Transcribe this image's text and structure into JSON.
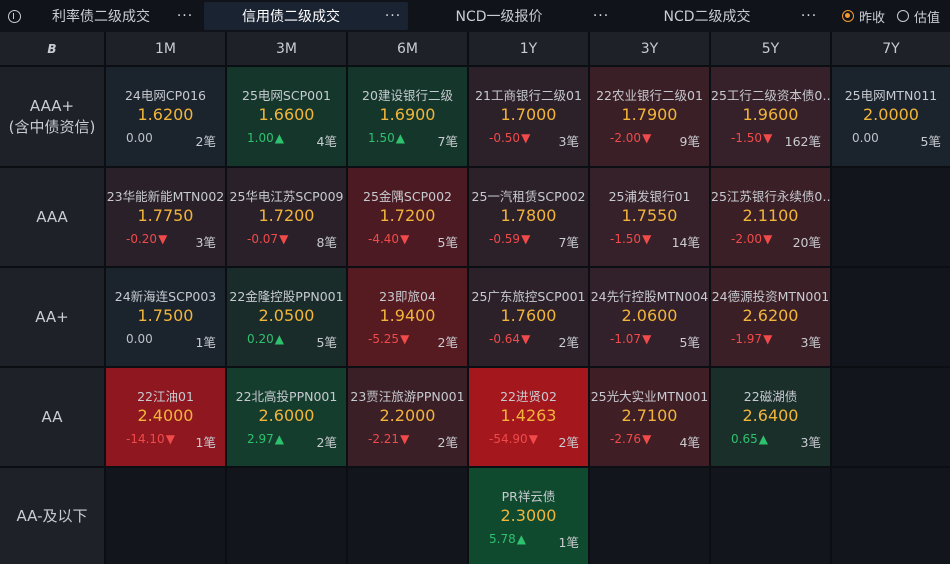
{
  "tabs": [
    {
      "label": "利率债二级成交",
      "active": false
    },
    {
      "label": "信用债二级成交",
      "active": true
    },
    {
      "label": "NCD一级报价",
      "active": false
    },
    {
      "label": "NCD二级成交",
      "active": false
    }
  ],
  "more_label": "···",
  "radio": [
    {
      "label": "昨收",
      "selected": true
    },
    {
      "label": "估值",
      "selected": false
    }
  ],
  "corner_label": "B",
  "columns": [
    "1M",
    "3M",
    "6M",
    "1Y",
    "3Y",
    "5Y",
    "7Y"
  ],
  "rows": [
    "AAA+\n(含中债资信)",
    "AAA",
    "AA+",
    "AA",
    "AA-及以下"
  ],
  "cells": [
    [
      {
        "name": "24电网CP016",
        "price": "1.6200",
        "change": "0.00",
        "arrow": "",
        "dir": "flat",
        "count": "2笔",
        "bg": "#1b232c"
      },
      {
        "name": "25电网SCP001",
        "price": "1.6600",
        "change": "1.00",
        "arrow": "▲",
        "dir": "up",
        "count": "4笔",
        "bg": "#15372b"
      },
      {
        "name": "20建设银行二级",
        "price": "1.6900",
        "change": "1.50",
        "arrow": "▲",
        "dir": "up",
        "count": "7笔",
        "bg": "#15372b"
      },
      {
        "name": "21工商银行二级01",
        "price": "1.7000",
        "change": "-0.50",
        "arrow": "▼",
        "dir": "down",
        "count": "3笔",
        "bg": "#2c2029"
      },
      {
        "name": "22农业银行二级01",
        "price": "1.7900",
        "change": "-2.00",
        "arrow": "▼",
        "dir": "down",
        "count": "9笔",
        "bg": "#3a1f26"
      },
      {
        "name": "25工行二级资本债0…",
        "price": "1.9600",
        "change": "-1.50",
        "arrow": "▼",
        "dir": "down",
        "count": "162笔",
        "bg": "#36212a"
      },
      {
        "name": "25电网MTN011",
        "price": "2.0000",
        "change": "0.00",
        "arrow": "",
        "dir": "flat",
        "count": "5笔",
        "bg": "#1b232c"
      }
    ],
    [
      {
        "name": "23华能新能MTN002",
        "price": "1.7750",
        "change": "-0.20",
        "arrow": "▼",
        "dir": "down",
        "count": "3笔",
        "bg": "#2a2029"
      },
      {
        "name": "25华电江苏SCP009",
        "price": "1.7200",
        "change": "-0.07",
        "arrow": "▼",
        "dir": "down",
        "count": "8笔",
        "bg": "#2a2029"
      },
      {
        "name": "25金隅SCP002",
        "price": "1.7200",
        "change": "-4.40",
        "arrow": "▼",
        "dir": "down",
        "count": "5笔",
        "bg": "#4c1a22"
      },
      {
        "name": "25一汽租赁SCP002",
        "price": "1.7800",
        "change": "-0.59",
        "arrow": "▼",
        "dir": "down",
        "count": "7笔",
        "bg": "#2c2029"
      },
      {
        "name": "25浦发银行01",
        "price": "1.7550",
        "change": "-1.50",
        "arrow": "▼",
        "dir": "down",
        "count": "14笔",
        "bg": "#36212a"
      },
      {
        "name": "25江苏银行永续债0…",
        "price": "2.1100",
        "change": "-2.00",
        "arrow": "▼",
        "dir": "down",
        "count": "20笔",
        "bg": "#3a1f26"
      },
      null
    ],
    [
      {
        "name": "24新海连SCP003",
        "price": "1.7500",
        "change": "0.00",
        "arrow": "",
        "dir": "flat",
        "count": "1笔",
        "bg": "#1b232c"
      },
      {
        "name": "22金隆控股PPN001",
        "price": "2.0500",
        "change": "0.20",
        "arrow": "▲",
        "dir": "up",
        "count": "5笔",
        "bg": "#1a2c29"
      },
      {
        "name": "23即旅04",
        "price": "1.9400",
        "change": "-5.25",
        "arrow": "▼",
        "dir": "down",
        "count": "2笔",
        "bg": "#561a21"
      },
      {
        "name": "25广东旅控SCP001",
        "price": "1.7600",
        "change": "-0.64",
        "arrow": "▼",
        "dir": "down",
        "count": "2笔",
        "bg": "#2c2029"
      },
      {
        "name": "24先行控股MTN004",
        "price": "2.0600",
        "change": "-1.07",
        "arrow": "▼",
        "dir": "down",
        "count": "5笔",
        "bg": "#32202a"
      },
      {
        "name": "24德源投资MTN001",
        "price": "2.6200",
        "change": "-1.97",
        "arrow": "▼",
        "dir": "down",
        "count": "3笔",
        "bg": "#3a1f26"
      },
      null
    ],
    [
      {
        "name": "22江油01",
        "price": "2.4000",
        "change": "-14.10",
        "arrow": "▼",
        "dir": "down",
        "count": "1笔",
        "bg": "#8e1720"
      },
      {
        "name": "22北高投PPN001",
        "price": "2.6000",
        "change": "2.97",
        "arrow": "▲",
        "dir": "up",
        "count": "2笔",
        "bg": "#153d2d"
      },
      {
        "name": "23贾汪旅游PPN001",
        "price": "2.2000",
        "change": "-2.21",
        "arrow": "▼",
        "dir": "down",
        "count": "2笔",
        "bg": "#3a1f26"
      },
      {
        "name": "22进贤02",
        "price": "1.4263",
        "change": "-54.90",
        "arrow": "▼",
        "dir": "down",
        "count": "2笔",
        "bg": "#a3171d"
      },
      {
        "name": "25光大实业MTN001",
        "price": "2.7100",
        "change": "-2.76",
        "arrow": "▼",
        "dir": "down",
        "count": "4笔",
        "bg": "#3f1e25"
      },
      {
        "name": "22磁湖债",
        "price": "2.6400",
        "change": "0.65",
        "arrow": "▲",
        "dir": "up",
        "count": "3笔",
        "bg": "#1a2e2a"
      },
      null
    ],
    [
      null,
      null,
      null,
      {
        "name": "PR祥云债",
        "price": "2.3000",
        "change": "5.78",
        "arrow": "▲",
        "dir": "up",
        "count": "1笔",
        "bg": "#0f4a2e"
      },
      null,
      null,
      null
    ]
  ]
}
